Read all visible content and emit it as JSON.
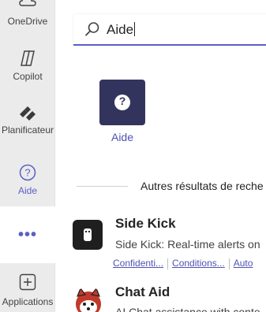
{
  "rail": {
    "onedrive_label": "OneDrive",
    "copilot_label": "Copilot",
    "planner_label": "Planificateur",
    "help_label": "Aide",
    "more_label": "•••",
    "apps_label": "Applications"
  },
  "search": {
    "value": "Aide"
  },
  "app_result": {
    "label": "Aide",
    "icon_glyph": "?"
  },
  "section": {
    "others_label": "Autres résultats de reche"
  },
  "results": [
    {
      "title": "Side Kick",
      "description": "Side Kick: Real-time alerts on",
      "links": [
        "Confidenti...",
        "Conditions...",
        "Auto"
      ]
    },
    {
      "title": "Chat Aid",
      "description": "AI Chat assistance with conte"
    }
  ],
  "colors": {
    "accent": "#5b5fc7",
    "tile_bg": "#33345e",
    "rail_bg": "#ebebeb"
  }
}
